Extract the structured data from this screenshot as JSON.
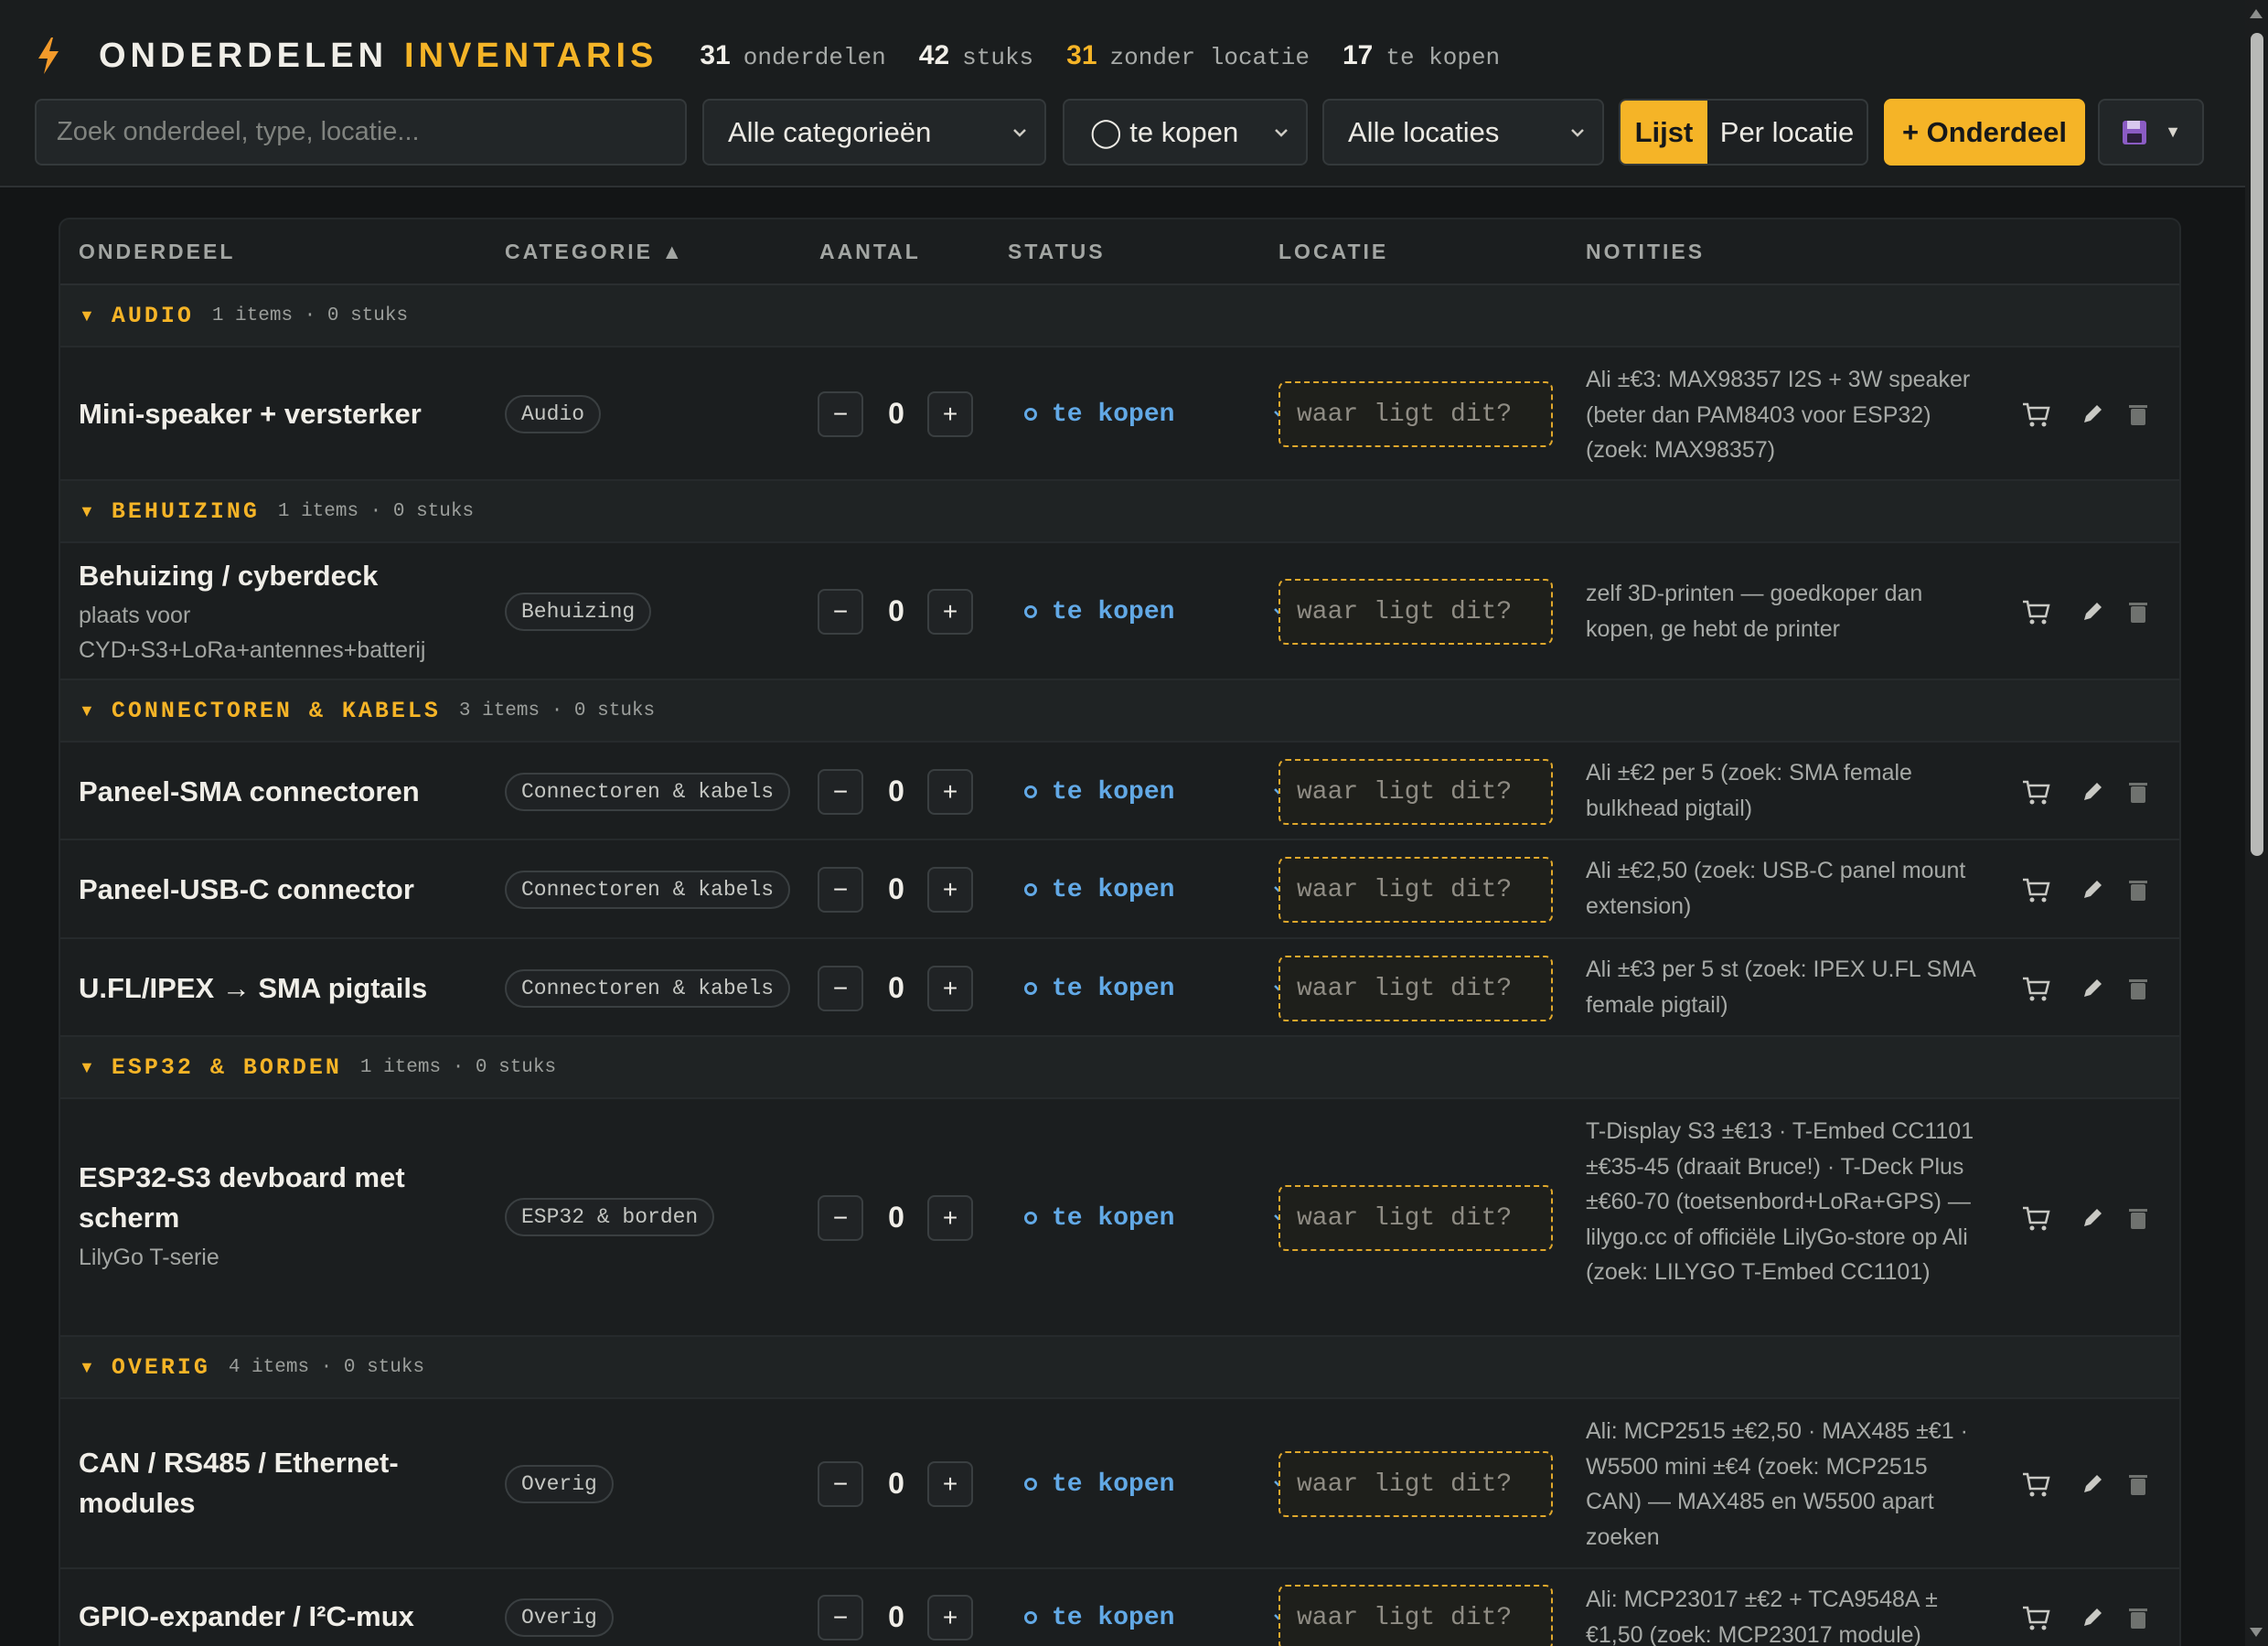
{
  "header": {
    "title_a": "ONDERDELEN",
    "title_b": "INVENTARIS",
    "stats": [
      {
        "num": "31",
        "label": "onderdelen"
      },
      {
        "num": "42",
        "label": "stuks"
      },
      {
        "num": "31",
        "label": "zonder locatie"
      },
      {
        "num": "17",
        "label": "te kopen"
      }
    ]
  },
  "controls": {
    "search_placeholder": "Zoek onderdeel, type, locatie...",
    "category_select": "Alle categorieën",
    "status_select": "◯ te kopen",
    "location_select": "Alle locaties",
    "view_list": "Lijst",
    "view_location": "Per locatie",
    "add_button": "+ Onderdeel"
  },
  "table": {
    "columns": [
      "ONDERDEEL",
      "CATEGORIE ▲",
      "AANTAL",
      "STATUS",
      "LOCATIE",
      "NOTITIES"
    ],
    "status_label": "te kopen",
    "location_placeholder": "waar ligt dit?",
    "groups": [
      {
        "name": "AUDIO",
        "meta": "1 items · 0 stuks"
      },
      {
        "name": "BEHUIZING",
        "meta": "1 items · 0 stuks"
      },
      {
        "name": "CONNECTOREN & KABELS",
        "meta": "3 items · 0 stuks"
      },
      {
        "name": "ESP32 & BORDEN",
        "meta": "1 items · 0 stuks"
      },
      {
        "name": "OVERIG",
        "meta": "4 items · 0 stuks"
      }
    ],
    "rows": [
      {
        "name": "Mini-speaker + versterker",
        "sub": "",
        "category": "Audio",
        "qty": "0",
        "notes": "Ali ±€3: MAX98357 I2S + 3W speaker (beter dan PAM8403 voor ESP32) (zoek: MAX98357)"
      },
      {
        "name": "Behuizing / cyberdeck",
        "sub": "plaats voor CYD+S3+LoRa+antennes+batterij",
        "category": "Behuizing",
        "qty": "0",
        "notes": "zelf 3D-printen — goedkoper dan kopen, ge hebt de printer"
      },
      {
        "name": "Paneel-SMA connectoren",
        "sub": "",
        "category": "Connectoren & kabels",
        "qty": "0",
        "notes": "Ali ±€2 per 5 (zoek: SMA female bulkhead pigtail)"
      },
      {
        "name": "Paneel-USB-C connector",
        "sub": "",
        "category": "Connectoren & kabels",
        "qty": "0",
        "notes": "Ali ±€2,50 (zoek: USB-C panel mount extension)"
      },
      {
        "name": "U.FL/IPEX → SMA pigtails",
        "sub": "",
        "category": "Connectoren & kabels",
        "qty": "0",
        "notes": "Ali ±€3 per 5 st (zoek: IPEX U.FL SMA female pigtail)"
      },
      {
        "name": "ESP32-S3 devboard met scherm",
        "sub": "LilyGo T-serie",
        "category": "ESP32 & borden",
        "qty": "0",
        "notes": "T-Display S3 ±€13 · T-Embed CC1101 ±€35-45 (draait Bruce!) · T-Deck Plus ±€60-70 (toetsenbord+LoRa+GPS) — lilygo.cc of officiële LilyGo-store op Ali (zoek: LILYGO T-Embed CC1101)"
      },
      {
        "name": "CAN / RS485 / Ethernet-modules",
        "sub": "",
        "category": "Overig",
        "qty": "0",
        "notes": "Ali: MCP2515 ±€2,50 · MAX485 ±€1 · W5500 mini ±€4 (zoek: MCP2515 CAN) — MAX485 en W5500 apart zoeken"
      },
      {
        "name": "GPIO-expander / I²C-mux",
        "sub": "",
        "category": "Overig",
        "qty": "0",
        "notes": "Ali: MCP23017 ±€2 + TCA9548A ±€1,50 (zoek: MCP23017 module)"
      }
    ]
  },
  "colors": {
    "accent": "#f5b427",
    "status": "#62a9e6",
    "background": "#131516"
  },
  "icons": [
    "bolt-icon",
    "chevron-down-icon",
    "save-icon",
    "cart-icon",
    "pencil-icon",
    "trash-icon"
  ]
}
